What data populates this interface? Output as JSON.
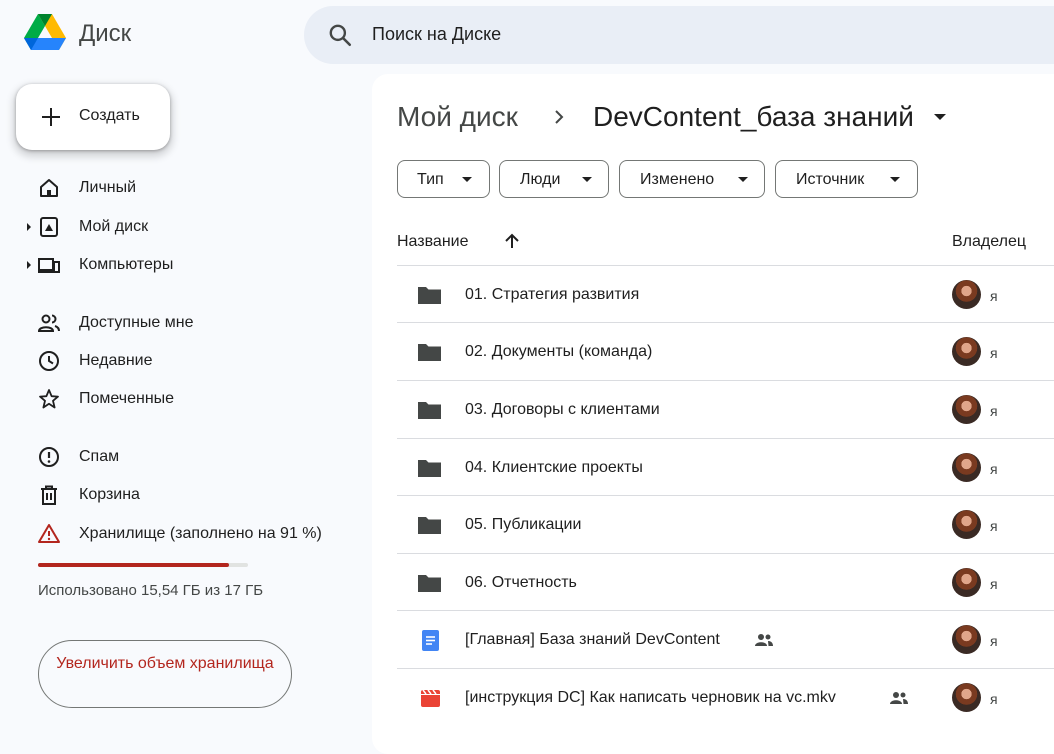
{
  "app": {
    "title": "Диск"
  },
  "search": {
    "placeholder": "Поиск на Диске"
  },
  "create": {
    "label": "Создать"
  },
  "nav": {
    "items": [
      {
        "label": "Личный",
        "icon": "home-icon"
      },
      {
        "label": "Мой диск",
        "icon": "my-drive-icon",
        "expandable": true
      },
      {
        "label": "Компьютеры",
        "icon": "computers-icon",
        "expandable": true
      },
      {
        "label": "Доступные мне",
        "icon": "shared-people-icon"
      },
      {
        "label": "Недавние",
        "icon": "clock-icon"
      },
      {
        "label": "Помеченные",
        "icon": "star-icon"
      },
      {
        "label": "Спам",
        "icon": "spam-icon"
      },
      {
        "label": "Корзина",
        "icon": "trash-icon"
      },
      {
        "label": "Хранилище (заполнено на 91 %)",
        "icon": "warning-icon"
      }
    ]
  },
  "storage": {
    "used_fraction": 0.91,
    "text": "Использовано 15,54 ГБ из 17 ГБ",
    "upgrade_label": "Увеличить объем хранилища"
  },
  "breadcrumb": {
    "root": "Мой диск",
    "current": "DevContent_база знаний"
  },
  "filters": [
    "Тип",
    "Люди",
    "Изменено",
    "Источник"
  ],
  "table": {
    "col_name": "Название",
    "col_owner": "Владелец",
    "rows": [
      {
        "name": "01. Стратегия развития",
        "type": "folder",
        "owner": "я"
      },
      {
        "name": "02. Документы (команда)",
        "type": "folder",
        "owner": "я"
      },
      {
        "name": "03. Договоры с клиентами",
        "type": "folder",
        "owner": "я"
      },
      {
        "name": "04. Клиентские проекты",
        "type": "folder",
        "owner": "я"
      },
      {
        "name": "05. Публикации",
        "type": "folder",
        "owner": "я"
      },
      {
        "name": "06. Отчетность",
        "type": "folder",
        "owner": "я"
      },
      {
        "name": "[Главная] База знаний DevContent",
        "type": "doc",
        "shared": true,
        "owner": "я"
      },
      {
        "name": "[инструкция DC] Как написать черновик на vc.mkv",
        "type": "video",
        "shared": true,
        "owner": "я"
      }
    ]
  },
  "colors": {
    "accent_red": "#b3261e",
    "doc_blue": "#4285f4",
    "video_red": "#ea4335",
    "folder": "#444746"
  }
}
